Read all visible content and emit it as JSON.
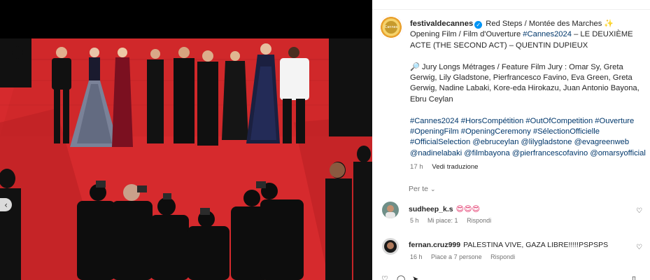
{
  "post": {
    "username": "festivaldecannes",
    "avatar_text": "Cannes",
    "caption_line1": " Red Steps / Montée des Marches ✨",
    "caption_line2a": "Opening Film / Film d'Ouverture ",
    "caption_tag_cannes": "#Cannes2024",
    "caption_line2b": " – LE DEUXIÈME ACTE (THE SECOND ACT) – QUENTIN DUPIEUX",
    "jury_text": "🔎 Jury Longs Métrages / Feature Film Jury : Omar Sy, Greta Gerwig, Lily Gladstone, Pierfrancesco Favino, Eva Green, Greta Gerwig, Nadine Labaki, Kore-eda Hirokazu, Juan Antonio Bayona, Ebru Ceylan",
    "hashtags": "#Cannes2024 #HorsCompétition #OutOfCompetition #Ouverture #OpeningFilm #OpeningCeremony #SélectionOfficielle #OfficialSelection @ebruceylan @lilygladstone @evagreenweb @nadinelabaki @filmbayona @pierfrancescofavino @omarsyofficial",
    "time": "17 h",
    "translate": "Vedi traduzione"
  },
  "for_you": {
    "label": "Per te",
    "chevron_icon": "chevron-down-icon"
  },
  "comments": [
    {
      "username": "sudheep_k.s",
      "text": "😍😍😍",
      "time": "5 h",
      "likes": "Mi piace: 1",
      "reply": "Rispondi"
    },
    {
      "username": "fernan.cruz999",
      "text": "PALESTINA VIVE, GAZA LIBRE!!!!!PSPSPS",
      "time": "16 h",
      "likes": "Piace a 7 persone",
      "reply": "Rispondi"
    }
  ],
  "icons": {
    "heart": "heart-icon",
    "prev": "chevron-left-icon",
    "verified": "verified-badge-icon"
  },
  "colors": {
    "accent_link": "#00376b",
    "verified": "#0095f6",
    "red_carpet": "#d1282b"
  }
}
